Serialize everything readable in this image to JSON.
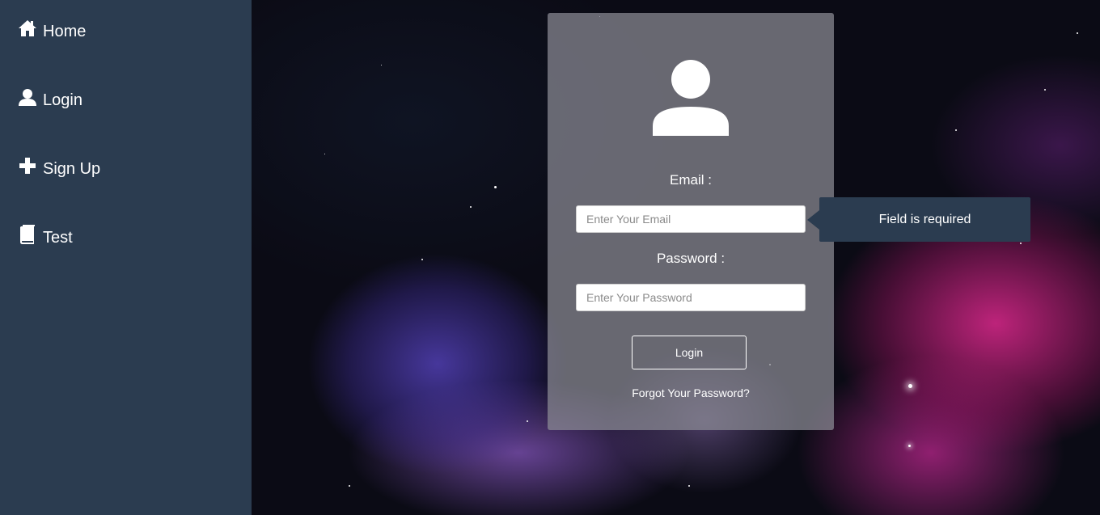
{
  "sidebar": {
    "items": [
      {
        "label": "Home",
        "icon": "home-icon"
      },
      {
        "label": "Login",
        "icon": "user-icon"
      },
      {
        "label": "Sign Up",
        "icon": "plus-icon"
      },
      {
        "label": "Test",
        "icon": "book-icon"
      }
    ]
  },
  "login_form": {
    "avatar_icon": "user-avatar-icon",
    "email_label": "Email :",
    "email_placeholder": "Enter Your Email",
    "email_value": "",
    "password_label": "Password :",
    "password_placeholder": "Enter Your Password",
    "password_value": "",
    "login_button": "Login",
    "forgot_password": "Forgot Your Password?"
  },
  "tooltip": {
    "message": "Field is required"
  },
  "colors": {
    "sidebar_bg": "#2b3c50",
    "tooltip_bg": "#2b3c50",
    "card_bg": "rgba(140,140,150,0.72)",
    "text": "#ffffff"
  }
}
